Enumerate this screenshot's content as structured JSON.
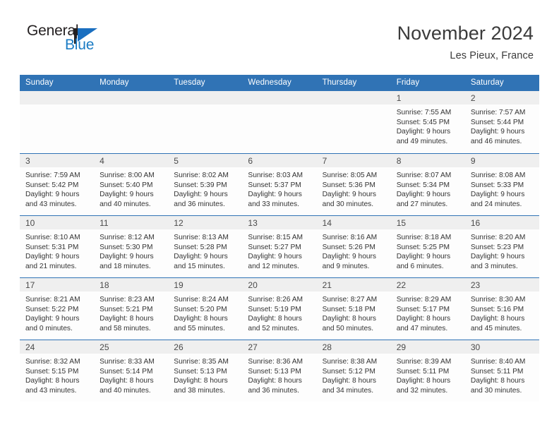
{
  "brand": {
    "name_part1": "General",
    "name_part2": "Blue",
    "mark": "triangle-flag-logo",
    "color_dark": "#231f20",
    "color_blue": "#1a7bc4"
  },
  "header": {
    "title": "November 2024",
    "location": "Les Pieux, France",
    "header_bg": "#3073b5",
    "daynum_bg": "#efefef"
  },
  "weekdays": [
    "Sunday",
    "Monday",
    "Tuesday",
    "Wednesday",
    "Thursday",
    "Friday",
    "Saturday"
  ],
  "weeks": [
    [
      {
        "day": "",
        "lines": []
      },
      {
        "day": "",
        "lines": []
      },
      {
        "day": "",
        "lines": []
      },
      {
        "day": "",
        "lines": []
      },
      {
        "day": "",
        "lines": []
      },
      {
        "day": "1",
        "lines": [
          "Sunrise: 7:55 AM",
          "Sunset: 5:45 PM",
          "Daylight: 9 hours",
          "and 49 minutes."
        ]
      },
      {
        "day": "2",
        "lines": [
          "Sunrise: 7:57 AM",
          "Sunset: 5:44 PM",
          "Daylight: 9 hours",
          "and 46 minutes."
        ]
      }
    ],
    [
      {
        "day": "3",
        "lines": [
          "Sunrise: 7:59 AM",
          "Sunset: 5:42 PM",
          "Daylight: 9 hours",
          "and 43 minutes."
        ]
      },
      {
        "day": "4",
        "lines": [
          "Sunrise: 8:00 AM",
          "Sunset: 5:40 PM",
          "Daylight: 9 hours",
          "and 40 minutes."
        ]
      },
      {
        "day": "5",
        "lines": [
          "Sunrise: 8:02 AM",
          "Sunset: 5:39 PM",
          "Daylight: 9 hours",
          "and 36 minutes."
        ]
      },
      {
        "day": "6",
        "lines": [
          "Sunrise: 8:03 AM",
          "Sunset: 5:37 PM",
          "Daylight: 9 hours",
          "and 33 minutes."
        ]
      },
      {
        "day": "7",
        "lines": [
          "Sunrise: 8:05 AM",
          "Sunset: 5:36 PM",
          "Daylight: 9 hours",
          "and 30 minutes."
        ]
      },
      {
        "day": "8",
        "lines": [
          "Sunrise: 8:07 AM",
          "Sunset: 5:34 PM",
          "Daylight: 9 hours",
          "and 27 minutes."
        ]
      },
      {
        "day": "9",
        "lines": [
          "Sunrise: 8:08 AM",
          "Sunset: 5:33 PM",
          "Daylight: 9 hours",
          "and 24 minutes."
        ]
      }
    ],
    [
      {
        "day": "10",
        "lines": [
          "Sunrise: 8:10 AM",
          "Sunset: 5:31 PM",
          "Daylight: 9 hours",
          "and 21 minutes."
        ]
      },
      {
        "day": "11",
        "lines": [
          "Sunrise: 8:12 AM",
          "Sunset: 5:30 PM",
          "Daylight: 9 hours",
          "and 18 minutes."
        ]
      },
      {
        "day": "12",
        "lines": [
          "Sunrise: 8:13 AM",
          "Sunset: 5:28 PM",
          "Daylight: 9 hours",
          "and 15 minutes."
        ]
      },
      {
        "day": "13",
        "lines": [
          "Sunrise: 8:15 AM",
          "Sunset: 5:27 PM",
          "Daylight: 9 hours",
          "and 12 minutes."
        ]
      },
      {
        "day": "14",
        "lines": [
          "Sunrise: 8:16 AM",
          "Sunset: 5:26 PM",
          "Daylight: 9 hours",
          "and 9 minutes."
        ]
      },
      {
        "day": "15",
        "lines": [
          "Sunrise: 8:18 AM",
          "Sunset: 5:25 PM",
          "Daylight: 9 hours",
          "and 6 minutes."
        ]
      },
      {
        "day": "16",
        "lines": [
          "Sunrise: 8:20 AM",
          "Sunset: 5:23 PM",
          "Daylight: 9 hours",
          "and 3 minutes."
        ]
      }
    ],
    [
      {
        "day": "17",
        "lines": [
          "Sunrise: 8:21 AM",
          "Sunset: 5:22 PM",
          "Daylight: 9 hours",
          "and 0 minutes."
        ]
      },
      {
        "day": "18",
        "lines": [
          "Sunrise: 8:23 AM",
          "Sunset: 5:21 PM",
          "Daylight: 8 hours",
          "and 58 minutes."
        ]
      },
      {
        "day": "19",
        "lines": [
          "Sunrise: 8:24 AM",
          "Sunset: 5:20 PM",
          "Daylight: 8 hours",
          "and 55 minutes."
        ]
      },
      {
        "day": "20",
        "lines": [
          "Sunrise: 8:26 AM",
          "Sunset: 5:19 PM",
          "Daylight: 8 hours",
          "and 52 minutes."
        ]
      },
      {
        "day": "21",
        "lines": [
          "Sunrise: 8:27 AM",
          "Sunset: 5:18 PM",
          "Daylight: 8 hours",
          "and 50 minutes."
        ]
      },
      {
        "day": "22",
        "lines": [
          "Sunrise: 8:29 AM",
          "Sunset: 5:17 PM",
          "Daylight: 8 hours",
          "and 47 minutes."
        ]
      },
      {
        "day": "23",
        "lines": [
          "Sunrise: 8:30 AM",
          "Sunset: 5:16 PM",
          "Daylight: 8 hours",
          "and 45 minutes."
        ]
      }
    ],
    [
      {
        "day": "24",
        "lines": [
          "Sunrise: 8:32 AM",
          "Sunset: 5:15 PM",
          "Daylight: 8 hours",
          "and 43 minutes."
        ]
      },
      {
        "day": "25",
        "lines": [
          "Sunrise: 8:33 AM",
          "Sunset: 5:14 PM",
          "Daylight: 8 hours",
          "and 40 minutes."
        ]
      },
      {
        "day": "26",
        "lines": [
          "Sunrise: 8:35 AM",
          "Sunset: 5:13 PM",
          "Daylight: 8 hours",
          "and 38 minutes."
        ]
      },
      {
        "day": "27",
        "lines": [
          "Sunrise: 8:36 AM",
          "Sunset: 5:13 PM",
          "Daylight: 8 hours",
          "and 36 minutes."
        ]
      },
      {
        "day": "28",
        "lines": [
          "Sunrise: 8:38 AM",
          "Sunset: 5:12 PM",
          "Daylight: 8 hours",
          "and 34 minutes."
        ]
      },
      {
        "day": "29",
        "lines": [
          "Sunrise: 8:39 AM",
          "Sunset: 5:11 PM",
          "Daylight: 8 hours",
          "and 32 minutes."
        ]
      },
      {
        "day": "30",
        "lines": [
          "Sunrise: 8:40 AM",
          "Sunset: 5:11 PM",
          "Daylight: 8 hours",
          "and 30 minutes."
        ]
      }
    ]
  ]
}
